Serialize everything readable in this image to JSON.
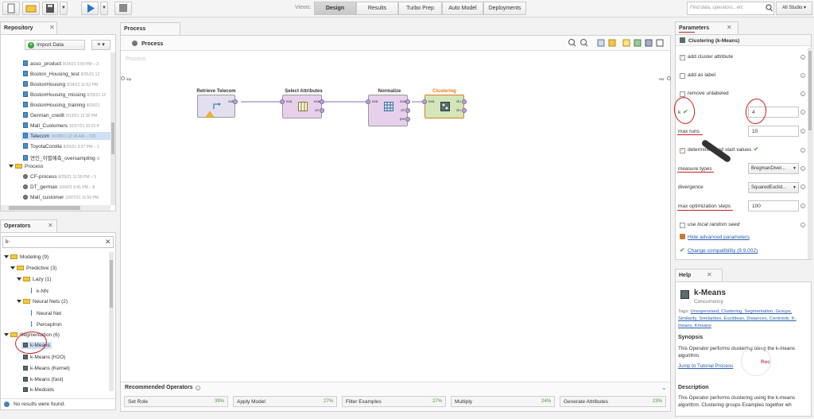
{
  "toolbar": {
    "views_label": "Views:",
    "views": [
      "Design",
      "Results",
      "Turbo Prep",
      "Auto Model",
      "Deployments"
    ],
    "active_view": "Design",
    "search_placeholder": "Find data, operators...etc",
    "studio_menu": "All Studio ▾"
  },
  "repository": {
    "tab": "Repository",
    "import_button": "Import Data",
    "items": [
      {
        "name": "asso_product",
        "meta": "9/14/21 3:00 PM – 3"
      },
      {
        "name": "Boston_Housing_test",
        "meta": "8/25/21 12"
      },
      {
        "name": "BostonHousing",
        "meta": "9/24/21 11:52 PM"
      },
      {
        "name": "BostonHousing_missing",
        "meta": "8/25/21 12"
      },
      {
        "name": "BostonHousing_training",
        "meta": "8/25/21"
      },
      {
        "name": "German_credit",
        "meta": "9/13/21 12:30 PM"
      },
      {
        "name": "Mall_Customers",
        "meta": "10/27/21 10:23 P"
      },
      {
        "name": "Telecom",
        "meta": "10/28/21 12:18 AM – 723"
      },
      {
        "name": "ToyotaCorolla",
        "meta": "8/20/21 3:27 PM – 1"
      },
      {
        "name": "연인_이별예측_oversampling",
        "meta": "9/"
      }
    ],
    "process_folder": "Process",
    "processes": [
      {
        "name": "CF-process",
        "meta": "8/25/21 11:59 PM – 5"
      },
      {
        "name": "DT_german",
        "meta": "10/4/21 9:41 PM – 8"
      },
      {
        "name": "Mall_customer",
        "meta": "10/27/21 11:59 PM"
      }
    ]
  },
  "operators": {
    "tab": "Operators",
    "search_value": "k-",
    "tree": [
      {
        "label": "Modeling (9)",
        "level": 0,
        "type": "folder"
      },
      {
        "label": "Predictive (3)",
        "level": 1,
        "type": "folder"
      },
      {
        "label": "Lazy (1)",
        "level": 2,
        "type": "folder"
      },
      {
        "label": "k-NN",
        "level": 3,
        "type": "leaf"
      },
      {
        "label": "Neural Nets (2)",
        "level": 2,
        "type": "folder"
      },
      {
        "label": "Neural Net",
        "level": 3,
        "type": "leaf"
      },
      {
        "label": "Perceptron",
        "level": 3,
        "type": "leaf"
      },
      {
        "label": "Segmentation (6)",
        "level": 1,
        "type": "folder"
      },
      {
        "label": "k-Means",
        "level": 2,
        "type": "op"
      },
      {
        "label": "k-Means (H2O)",
        "level": 2,
        "type": "op"
      },
      {
        "label": "k-Means (Kernel)",
        "level": 2,
        "type": "op"
      },
      {
        "label": "k-Means (fast)",
        "level": 2,
        "type": "op"
      },
      {
        "label": "k-Medoids",
        "level": 2,
        "type": "op"
      }
    ],
    "status": "No results were found."
  },
  "process": {
    "tab": "Process",
    "breadcrumb": "Process",
    "watermark": "Process",
    "inp_label": "inp",
    "res_label": "res",
    "operators": [
      {
        "title": "Retrieve Telecom",
        "ports_out": [
          "out"
        ]
      },
      {
        "title": "Select Attributes",
        "ports_in": [
          "exa"
        ],
        "ports_out": [
          "exa",
          "ori"
        ]
      },
      {
        "title": "Normalize",
        "ports_in": [
          "exa"
        ],
        "ports_out": [
          "exa",
          "ori",
          "pre"
        ]
      },
      {
        "title": "Clustering",
        "ports_in": [
          "exa"
        ],
        "ports_out": [
          "clu",
          "clu"
        ]
      }
    ]
  },
  "recommended": {
    "title": "Recommended Operators",
    "items": [
      {
        "label": "Set Role",
        "pct": "39%"
      },
      {
        "label": "Apply Model",
        "pct": "27%"
      },
      {
        "label": "Filter Examples",
        "pct": "27%"
      },
      {
        "label": "Multiply",
        "pct": "24%"
      },
      {
        "label": "Generate Attributes",
        "pct": "23%"
      }
    ]
  },
  "parameters": {
    "tab": "Parameters",
    "operator": "Clustering (k-Means)",
    "add_cluster_attribute": "add cluster attribute",
    "add_as_label": "add as label",
    "remove_unlabeled": "remove unlabeled",
    "k_label": "k",
    "k_value": "4",
    "max_runs_label": "max runs",
    "max_runs_value": "10",
    "determine_good_start": "determine good start values",
    "measure_types_label": "measure types",
    "measure_types_value": "BregmanDiver...",
    "divergence_label": "divergence",
    "divergence_value": "SquaredEuclid...",
    "max_opt_label": "max optimization steps",
    "max_opt_value": "100",
    "use_local_seed": "use local random seed",
    "hide_advanced": "Hide advanced parameters",
    "change_compat": "Change compatibility (9.9.002)"
  },
  "help": {
    "tab": "Help",
    "title": "k-Means",
    "subtitle": "Concurrency",
    "tags_prefix": "Tags:",
    "tags": "Unsupervised, Clustering, Segmentation, Groups, Similarity, Similarities, Euclidean, Distances, Centroids, K-means, Kmeans",
    "synopsis_title": "Synopsis",
    "synopsis": "This Operator performs clustering using the k-means algorithm.",
    "tutorial_link": "Jump to Tutorial Process",
    "rec_label": "Rec",
    "description_title": "Description",
    "description": "This Operator performs clustering using the k-means algorithm. Clustering groups Examples together wh"
  },
  "colors": {
    "annotation": "#d01f1f",
    "select_attr_fill": "#e7d0ec",
    "clustering_fill": "#d3e6b8",
    "clustering_title": "#e07b1a",
    "accent_link": "#2a5fb0"
  }
}
